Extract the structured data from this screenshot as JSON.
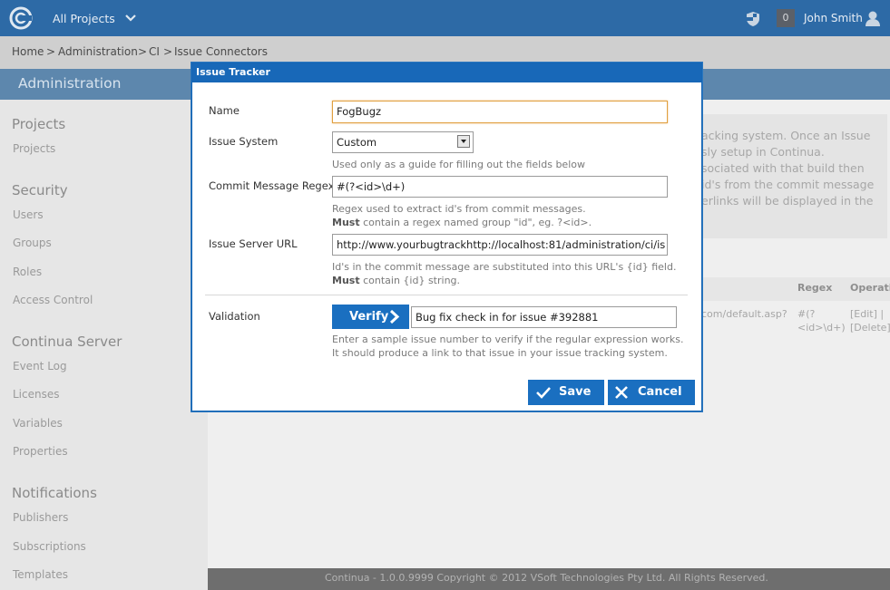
{
  "topbar": {
    "projects_label": "All Projects",
    "notifications_count": "0",
    "user_name": "John Smith"
  },
  "breadcrumb": {
    "home": "Home",
    "sep": ">",
    "administration": "Administration",
    "ci": "CI",
    "current": "Issue Connectors"
  },
  "page": {
    "section_title": "Administration"
  },
  "sidebar": {
    "projects": {
      "heading": "Projects",
      "items": [
        "Projects"
      ]
    },
    "security": {
      "heading": "Security",
      "items": [
        "Users",
        "Groups",
        "Roles",
        "Access Control"
      ]
    },
    "server": {
      "heading": "Continua Server",
      "items": [
        "Event Log",
        "Licenses",
        "Variables",
        "Properties"
      ]
    },
    "notifications": {
      "heading": "Notifications",
      "items": [
        "Publishers",
        "Subscriptions",
        "Templates"
      ]
    }
  },
  "background": {
    "info_lines": [
      "acking system. Once an Issue",
      "sly setup in Continua.",
      "sociated with that build then",
      "id's from the commit message",
      "erlinks will be displayed in the"
    ],
    "table": {
      "col_regex": "Regex",
      "col_operations": "Operatio",
      "url_fragment": "com/default.asp?",
      "regex_line1": "#(?",
      "regex_line2": "<id>\\d+)",
      "edit": "[Edit] |",
      "delete": "[Delete]"
    }
  },
  "footer": {
    "text": "Continua - 1.0.0.9999 Copyright © 2012 VSoft Technologies Pty Ltd. All Rights Reserved."
  },
  "dialog": {
    "title": "Issue Tracker",
    "name_label": "Name",
    "name_value": "FogBugz",
    "issue_system_label": "Issue System",
    "issue_system_value": "Custom",
    "issue_system_hint": "Used only as a guide for filling out the fields below",
    "regex_label": "Commit Message Regex",
    "regex_value": "#(?<id>\\d+)",
    "regex_hint_line1": "Regex used to extract id's from commit messages.",
    "regex_hint_must": "Must",
    "regex_hint_line2": " contain a regex named group \"id\", eg. ?<id>.",
    "url_label": "Issue Server URL",
    "url_value": "http://www.yourbugtrackhttp://localhost:81/administration/ci/is",
    "url_hint_line1": "Id's in the commit message are substituted into this URL's {id} field.",
    "url_hint_must": "Must",
    "url_hint_line2": " contain {id} string.",
    "validation_label": "Validation",
    "verify_label": "Verify",
    "validation_value": "Bug fix check in for issue #392881",
    "validation_hint_line1": "Enter a sample issue number to verify if the regular expression works.",
    "validation_hint_line2": "It should produce a link to that issue in your issue tracking system.",
    "save_label": "Save",
    "cancel_label": "Cancel"
  },
  "colors": {
    "topbar": "#2d6aa6",
    "dialog_accent": "#1868b8",
    "button": "#1a6fc0",
    "focus_border": "#e0a040"
  }
}
